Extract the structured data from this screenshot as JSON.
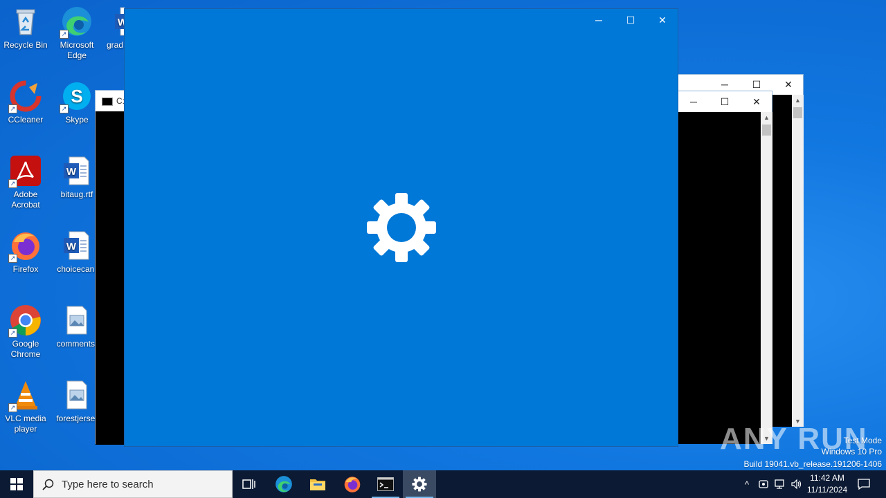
{
  "desktop": {
    "icons": [
      {
        "label": "Recycle Bin"
      },
      {
        "label": "Microsoft\nEdge"
      },
      {
        "label": "grad"
      },
      {
        "label": "CCleaner"
      },
      {
        "label": "Skype"
      },
      {
        "label": "Adobe\nAcrobat"
      },
      {
        "label": "bitaug.rtf"
      },
      {
        "label": "Firefox"
      },
      {
        "label": "choicecan."
      },
      {
        "label": "Google\nChrome"
      },
      {
        "label": "comments."
      },
      {
        "label": "VLC media\nplayer"
      },
      {
        "label": "forestjerse."
      }
    ]
  },
  "console_window": {
    "title_fragment": "C:"
  },
  "settings_window": {
    "icon": "gear-icon"
  },
  "watermark": {
    "brand": "ANY RUN",
    "line1": "Test Mode",
    "line2": "Windows 10 Pro",
    "line3": "Build 19041.vb_release.191206-1406"
  },
  "taskbar": {
    "search_placeholder": "Type here to search",
    "clock_time": "11:42 AM",
    "clock_date": "11/11/2024"
  },
  "colors": {
    "settings_bg": "#0078d7",
    "taskbar_bg": "#0c1a33"
  }
}
